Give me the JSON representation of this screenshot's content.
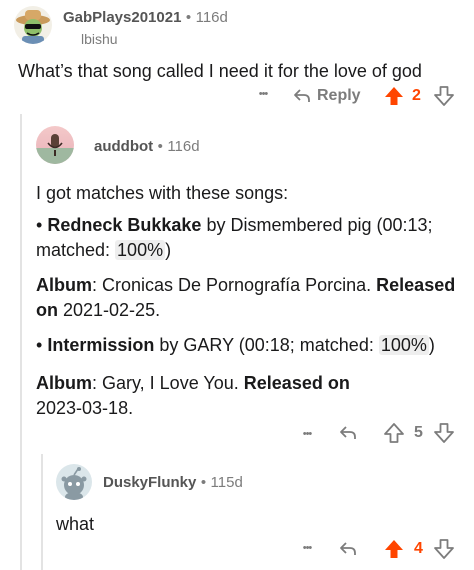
{
  "comment1": {
    "username": "GabPlays201021",
    "separator": "•",
    "age": "116d",
    "flair": "lbishu",
    "text": "What’s that song called I need it for the love of god",
    "actions": {
      "more": "•••",
      "reply_label": "Reply",
      "score": "2"
    }
  },
  "comment2": {
    "username": "auddbot",
    "separator": "•",
    "age": "116d",
    "intro": "I got matches with these songs:",
    "match1": {
      "bullet": "•",
      "title": "Redneck Bukkake",
      "by": "by Dismembered pig (00:13;",
      "matched_prefix": "matched: ",
      "matched_value": "100%",
      "close": ")",
      "album_label": "Album",
      "album_value": ": Cronicas De Pornografía Porcina.",
      "released_label": "Released on",
      "released_value": " 2021-02-25."
    },
    "match2": {
      "bullet": "•",
      "title": "Intermission",
      "by": "by GARY (00:18; matched: ",
      "matched_value": "100%",
      "close": ")",
      "album_label": "Album",
      "album_value": ": Gary, I Love You.",
      "released_label": "Released on",
      "released_value": "2023-03-18."
    },
    "actions": {
      "more": "•••",
      "score": "5"
    }
  },
  "comment3": {
    "username": "DuskyFlunky",
    "separator": "•",
    "age": "115d",
    "text": "what",
    "actions": {
      "more": "•••",
      "score": "4"
    }
  },
  "colors": {
    "upvote_active": "#ff4500",
    "muted": "#7c7c7c",
    "thread_line": "#e3e3e3"
  },
  "icons": [
    "cowboy-avatar-icon",
    "microphone-avatar-icon",
    "snoo-avatar-icon",
    "reply-arrow-icon",
    "upvote-icon",
    "downvote-icon",
    "more-icon"
  ]
}
